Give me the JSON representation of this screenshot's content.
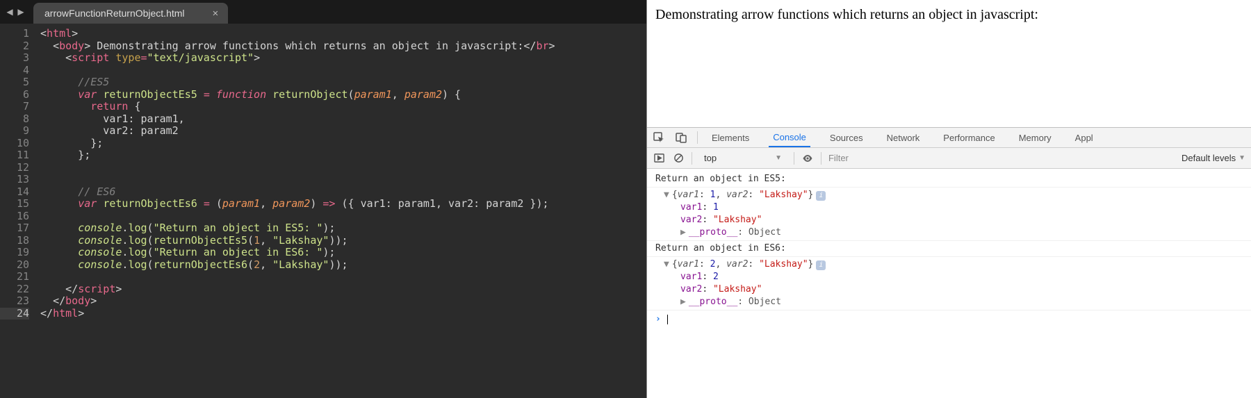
{
  "editor": {
    "tab_title": "arrowFunctionReturnObject.html",
    "line_numbers": [
      "1",
      "2",
      "3",
      "4",
      "5",
      "6",
      "7",
      "8",
      "9",
      "10",
      "11",
      "12",
      "13",
      "14",
      "15",
      "16",
      "17",
      "18",
      "19",
      "20",
      "21",
      "22",
      "23",
      "24"
    ],
    "active_line_idx": 23,
    "code_tokens": {
      "l1_tag": "html",
      "l2_tag": "body",
      "l2_text": " Demonstrating arrow functions which returns an object in javascript:",
      "l2_tag2": "br",
      "l3_tag": "script",
      "l3_attr": "type",
      "l3_val": "\"text/javascript\"",
      "l5_comment": "//ES5",
      "l6_var": "var",
      "l6_name": "returnObjectEs5",
      "l6_func": "function",
      "l6_fn": "returnObject",
      "l6_p1": "param1",
      "l6_p2": "param2",
      "l7_return": "return",
      "l8_k": "var1",
      "l8_v": "param1",
      "l9_k": "var2",
      "l9_v": "param2",
      "l14_comment": "// ES6",
      "l15_var": "var",
      "l15_name": "returnObjectEs6",
      "l15_p1": "param1",
      "l15_p2": "param2",
      "l15_k1": "var1",
      "l15_v1": "param1",
      "l15_k2": "var2",
      "l15_v2": "param2",
      "l17_obj": "console",
      "l17_m": "log",
      "l17_s": "\"Return an object in ES5: \"",
      "l18_obj": "console",
      "l18_m": "log",
      "l18_fn": "returnObjectEs5",
      "l18_a1": "1",
      "l18_a2": "\"Lakshay\"",
      "l19_obj": "console",
      "l19_m": "log",
      "l19_s": "\"Return an object in ES6: \"",
      "l20_obj": "console",
      "l20_m": "log",
      "l20_fn": "returnObjectEs6",
      "l20_a1": "2",
      "l20_a2": "\"Lakshay\"",
      "l22_tag": "script",
      "l23_tag": "body",
      "l24_tag": "html"
    }
  },
  "page": {
    "heading": "Demonstrating arrow functions which returns an object in javascript:"
  },
  "devtools": {
    "tabs": [
      "Elements",
      "Console",
      "Sources",
      "Network",
      "Performance",
      "Memory",
      "Appl"
    ],
    "active_tab": "Console",
    "context": "top",
    "filter_placeholder": "Filter",
    "levels": "Default levels",
    "logs": [
      {
        "type": "text",
        "msg": "Return an object in ES5: "
      },
      {
        "type": "obj",
        "summary_k1": "var1",
        "summary_v1": "1",
        "summary_k2": "var2",
        "summary_v2": "\"Lakshay\"",
        "props": [
          {
            "k": "var1",
            "v": "1",
            "num": true
          },
          {
            "k": "var2",
            "v": "\"Lakshay\"",
            "num": false
          }
        ],
        "proto": "Object"
      },
      {
        "type": "text",
        "msg": "Return an object in ES6: "
      },
      {
        "type": "obj",
        "summary_k1": "var1",
        "summary_v1": "2",
        "summary_k2": "var2",
        "summary_v2": "\"Lakshay\"",
        "props": [
          {
            "k": "var1",
            "v": "2",
            "num": true
          },
          {
            "k": "var2",
            "v": "\"Lakshay\"",
            "num": false
          }
        ],
        "proto": "Object"
      }
    ]
  }
}
